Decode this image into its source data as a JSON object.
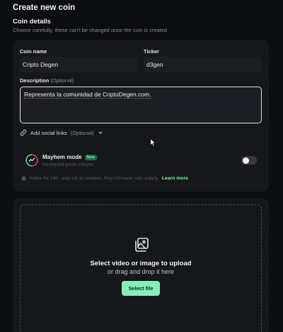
{
  "page": {
    "title": "Create new coin"
  },
  "coin_details": {
    "title": "Coin details",
    "subtitle": "Choose carefully, these can't be changed once the coin is created"
  },
  "form": {
    "coin_name": {
      "label": "Coin name",
      "value": "Cripto Degen"
    },
    "ticker": {
      "label": "Ticker",
      "value": "d3gen"
    },
    "description": {
      "label": "Description",
      "optional": "(Optional)",
      "value": "Representa la comunidad de CriptoDegen.com."
    },
    "social_links": {
      "label": "Add social links",
      "optional": "(Optional)"
    }
  },
  "mayhem": {
    "title": "Mayhem mode",
    "badge": "New",
    "subtitle": "Increased price volume",
    "enabled": false,
    "note": "Active for 24h, only set at creation. May increase coin supply.",
    "learn_more": "Learn more"
  },
  "upload": {
    "title": "Select video or image to upload",
    "subtitle": "or drag and drop it here",
    "button": "Select file"
  },
  "colors": {
    "background": "#0c0d10",
    "card": "#16171b",
    "accent": "#86eeb6"
  }
}
